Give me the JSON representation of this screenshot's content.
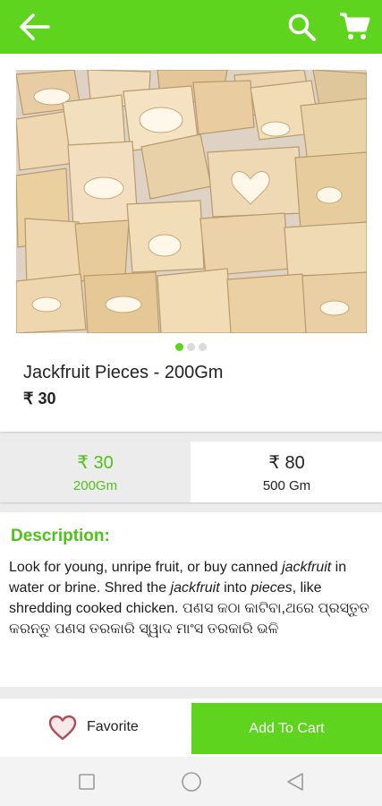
{
  "appbar": {
    "color": "#5fd41f",
    "back_icon": "arrow-left-icon",
    "search_icon": "search-icon",
    "cart_icon": "cart-icon"
  },
  "product": {
    "title": "Jackfruit Pieces - 200Gm",
    "price": "₹ 30",
    "image_carousel": {
      "count": 3,
      "active": 1
    }
  },
  "variants": [
    {
      "price": "₹ 30",
      "weight": "200Gm",
      "selected": true
    },
    {
      "price": "₹ 80",
      "weight": "500 Gm",
      "selected": false
    }
  ],
  "description": {
    "heading": "Description:",
    "segments": [
      "Look for young, unripe fruit, or buy canned ",
      "jackfruit",
      " in water or brine. Shred the ",
      "jackfruit",
      " into ",
      "pieces",
      ", like shredding cooked chicken. ପଣସ କଠା କାଟିବା,ଥରେ ପ୍ରସ୍ତୁତ କରନ୍ତୁ ପଣସ ତରକାରି ସ୍ୱାଦ ମାଂସ ତରକାରି ଭଳି"
    ]
  },
  "actions": {
    "favorite_label": "Favorite",
    "add_to_cart_label": "Add To Cart",
    "heart_icon": "heart-icon"
  },
  "system_nav": {
    "recents_icon": "square-icon",
    "home_icon": "circle-icon",
    "back_icon": "triangle-back-icon"
  },
  "colors": {
    "brand_green": "#5fd41f",
    "accent_text": "#4fc21a",
    "heart": "#b54a55"
  }
}
